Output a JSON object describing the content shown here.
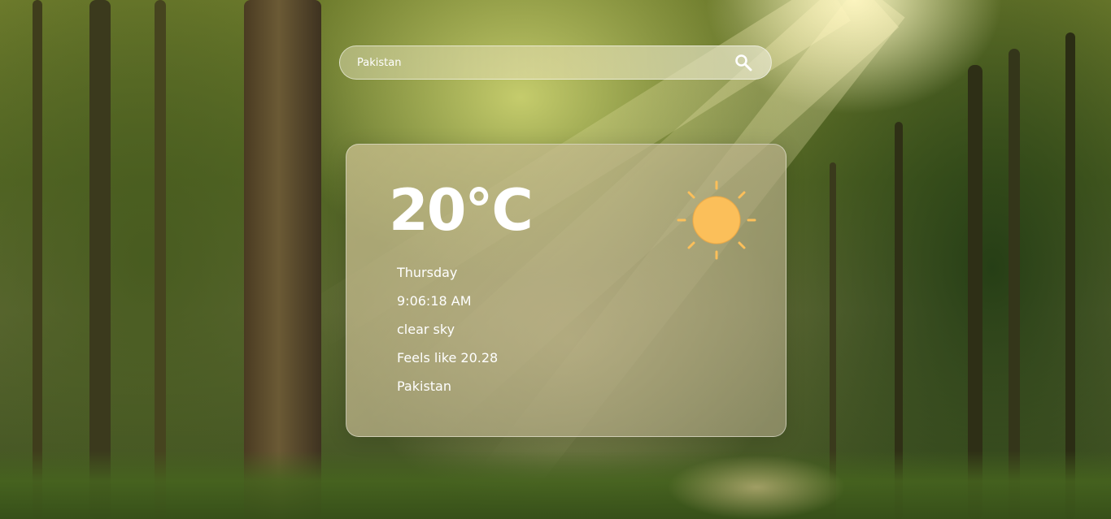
{
  "search": {
    "value": "Pakistan",
    "placeholder": "Pakistan"
  },
  "weather": {
    "temperature": "20°C",
    "day": "Thursday",
    "time": "9:06:18 AM",
    "description": "clear sky",
    "feels_like": "Feels like 20.28",
    "location": "Pakistan",
    "icon": "sun-icon"
  },
  "colors": {
    "sun": "#FBBF5A",
    "sun_rays": "#FBBF5A",
    "text": "#FFFFFF"
  }
}
